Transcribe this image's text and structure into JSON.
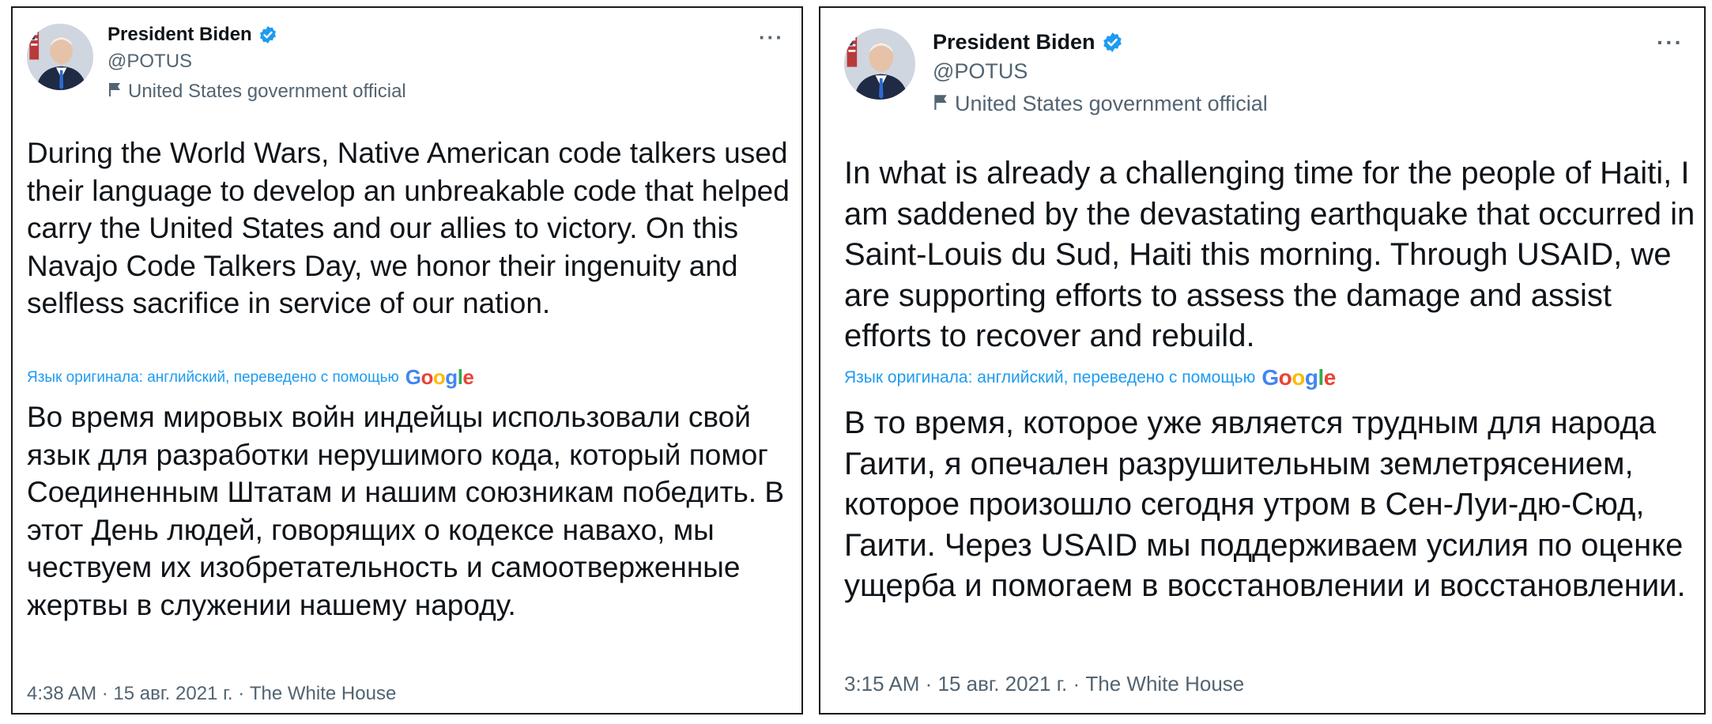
{
  "tweets": [
    {
      "author": {
        "name": "President Biden",
        "handle": "@POTUS",
        "label": "United States government official",
        "verified": true
      },
      "more_icon": "···",
      "text_original": "During the World Wars, Native American code talkers used their language to develop an unbreakable code that helped carry the United States and our allies to victory. On this Navajo Code Talkers Day, we honor their ingenuity and selfless sacrifice in service of our nation.",
      "translation_note": "Язык оригинала: английский, переведено с помощью",
      "translation_provider": "Google",
      "text_translated": "Во время мировых войн индейцы использовали свой язык для разработки нерушимого кода, который помог Соединенным Штатам и нашим союзникам победить. В этот День людей, говорящих о кодексе навахо, мы чествуем их изобретательность и самоотверженные жертвы в служении нашему народу.",
      "meta": "4:38 AM · 15 авг. 2021 г. · The White House"
    },
    {
      "author": {
        "name": "President Biden",
        "handle": "@POTUS",
        "label": "United States government official",
        "verified": true
      },
      "more_icon": "···",
      "text_original": "In what is already a challenging time for the people of Haiti, I am saddened by the devastating earthquake that occurred in Saint-Louis du Sud, Haiti this morning. Through USAID, we are supporting efforts to assess the damage and assist efforts to recover and rebuild.",
      "translation_note": "Язык оригинала: английский, переведено с помощью",
      "translation_provider": "Google",
      "text_translated": "В то время, которое уже является трудным для народа Гаити, я опечален разрушительным землетрясением, которое произошло сегодня утром в Сен-Луи-дю-Сюд, Гаити. Через USAID мы поддерживаем усилия по оценке ущерба и помогаем в восстановлении и восстановлении.",
      "meta": "3:15 AM · 15 авг. 2021 г. · The White House"
    }
  ],
  "colors": {
    "text": "#0f1419",
    "secondary": "#536471",
    "link": "#1d9bf0",
    "verified": "#1d9bf0"
  },
  "icons": [
    "avatar-portrait",
    "verified-badge-icon",
    "flag-icon",
    "more-options-icon"
  ]
}
